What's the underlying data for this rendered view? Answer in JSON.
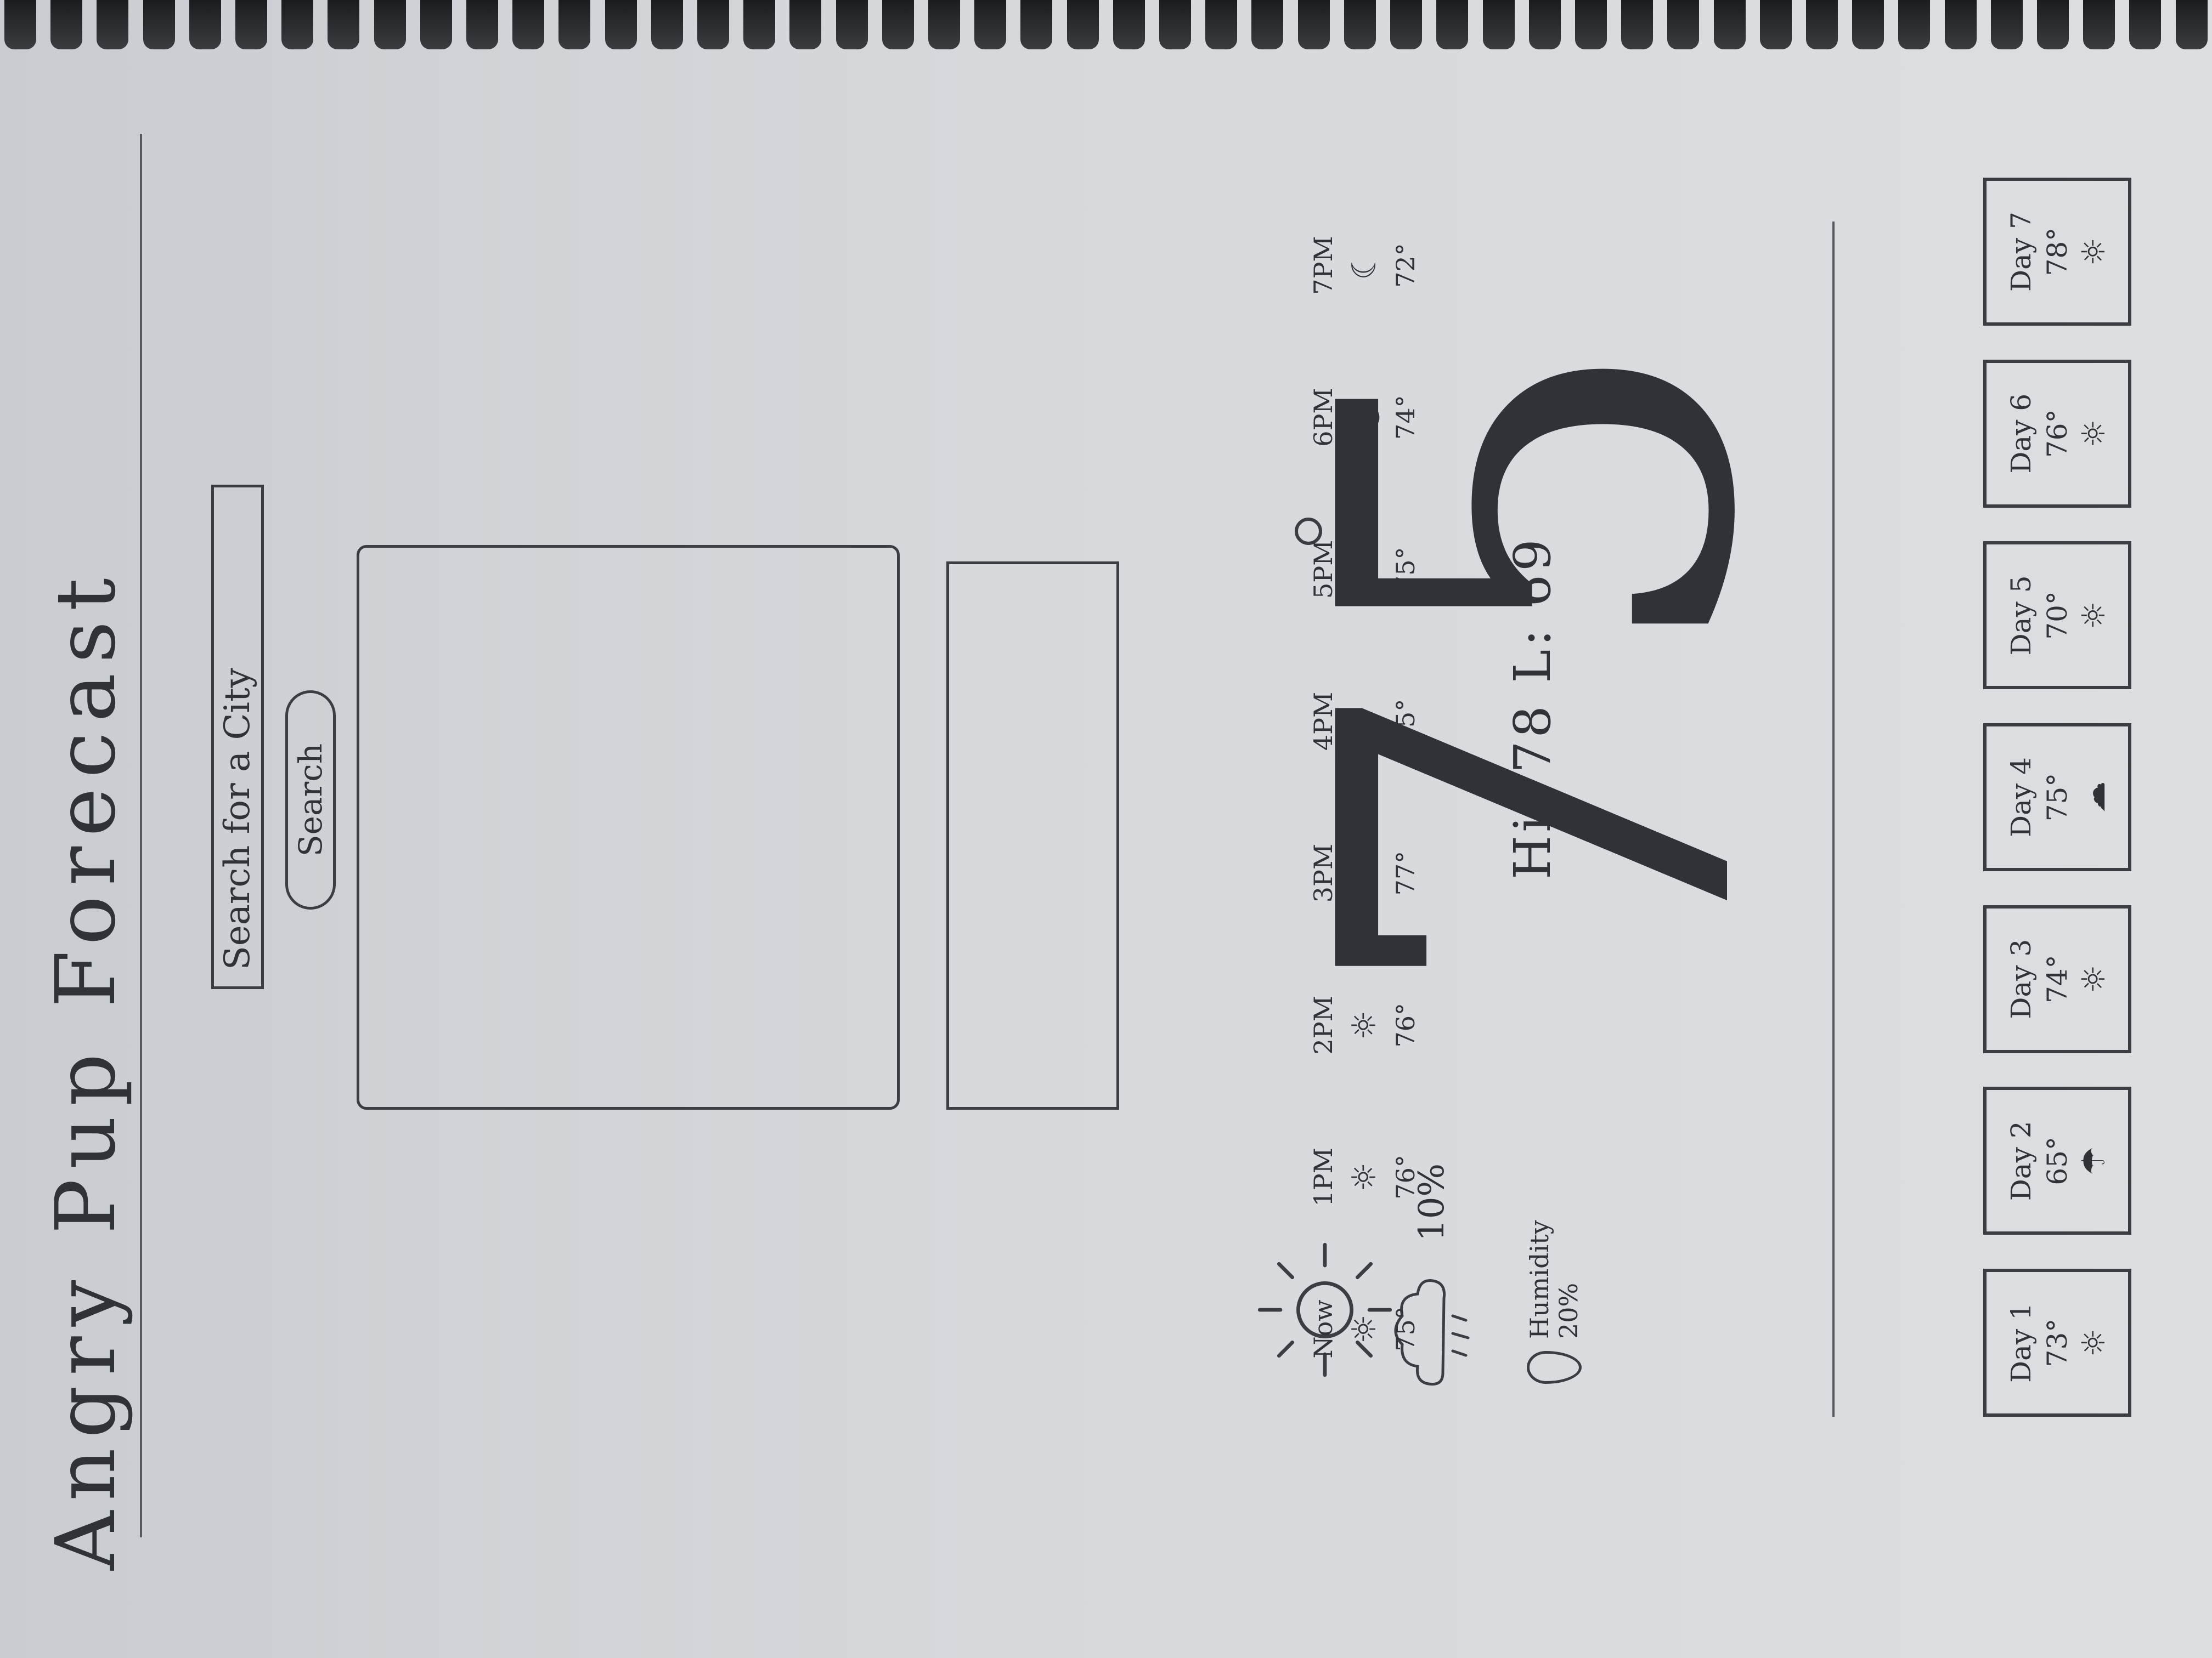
{
  "header": {
    "title": "Angry Pup Forecast"
  },
  "search": {
    "placeholder": "Search for a City",
    "button_label": "Search"
  },
  "current": {
    "temperature": "75",
    "hi_lo": "Hi: 78  L: 69",
    "condition_icon": "sun-icon",
    "precip_icon": "rain-cloud-icon",
    "precip_chance": "10%",
    "humidity_label": "Humidity",
    "humidity_value": "20%"
  },
  "hourly": [
    {
      "time": "Now",
      "icon": "sun-icon",
      "temp": "75°"
    },
    {
      "time": "1PM",
      "icon": "sun-icon",
      "temp": "76°"
    },
    {
      "time": "2PM",
      "icon": "sun-icon",
      "temp": "76°"
    },
    {
      "time": "3PM",
      "icon": "sun-icon",
      "temp": "77°"
    },
    {
      "time": "4PM",
      "icon": "sun-icon",
      "temp": "75°"
    },
    {
      "time": "5PM",
      "icon": "sun-icon",
      "temp": "75°"
    },
    {
      "time": "6PM",
      "icon": "sunset-icon",
      "temp": "74°"
    },
    {
      "time": "7PM",
      "icon": "moon-icon",
      "temp": "72°"
    }
  ],
  "daily": [
    {
      "day": "Day 1",
      "temp": "73°",
      "icon": "sun-icon"
    },
    {
      "day": "Day 2",
      "temp": "65°",
      "icon": "rain-cloud-icon"
    },
    {
      "day": "Day 3",
      "temp": "74°",
      "icon": "sun-icon"
    },
    {
      "day": "Day 4",
      "temp": "75°",
      "icon": "cloud-icon"
    },
    {
      "day": "Day 5",
      "temp": "70°",
      "icon": "sun-icon"
    },
    {
      "day": "Day 6",
      "temp": "76°",
      "icon": "sun-icon"
    },
    {
      "day": "Day 7",
      "temp": "78°",
      "icon": "sun-icon"
    }
  ]
}
